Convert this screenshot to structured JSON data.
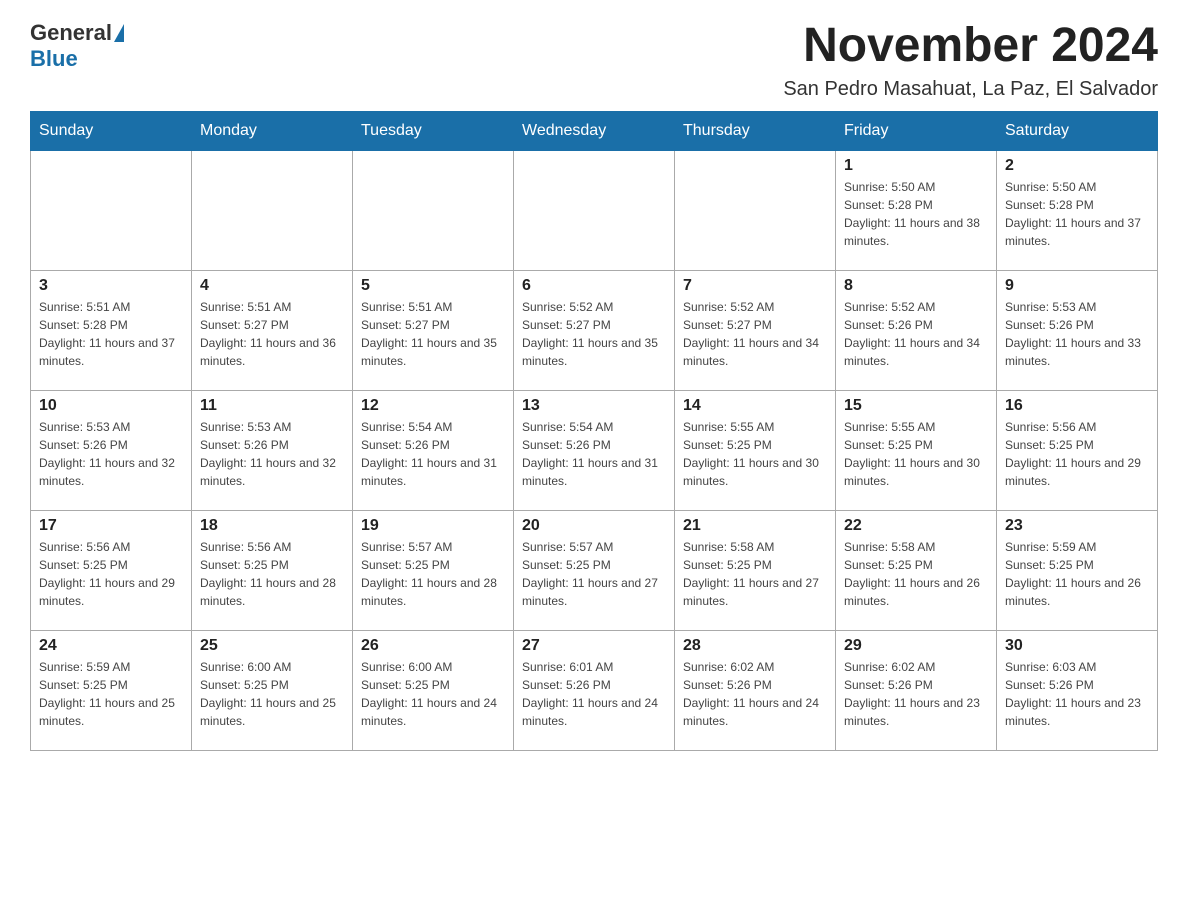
{
  "logo": {
    "general": "General",
    "blue": "Blue"
  },
  "header": {
    "title": "November 2024",
    "subtitle": "San Pedro Masahuat, La Paz, El Salvador"
  },
  "weekdays": [
    "Sunday",
    "Monday",
    "Tuesday",
    "Wednesday",
    "Thursday",
    "Friday",
    "Saturday"
  ],
  "weeks": [
    [
      {
        "day": "",
        "info": ""
      },
      {
        "day": "",
        "info": ""
      },
      {
        "day": "",
        "info": ""
      },
      {
        "day": "",
        "info": ""
      },
      {
        "day": "",
        "info": ""
      },
      {
        "day": "1",
        "info": "Sunrise: 5:50 AM\nSunset: 5:28 PM\nDaylight: 11 hours and 38 minutes."
      },
      {
        "day": "2",
        "info": "Sunrise: 5:50 AM\nSunset: 5:28 PM\nDaylight: 11 hours and 37 minutes."
      }
    ],
    [
      {
        "day": "3",
        "info": "Sunrise: 5:51 AM\nSunset: 5:28 PM\nDaylight: 11 hours and 37 minutes."
      },
      {
        "day": "4",
        "info": "Sunrise: 5:51 AM\nSunset: 5:27 PM\nDaylight: 11 hours and 36 minutes."
      },
      {
        "day": "5",
        "info": "Sunrise: 5:51 AM\nSunset: 5:27 PM\nDaylight: 11 hours and 35 minutes."
      },
      {
        "day": "6",
        "info": "Sunrise: 5:52 AM\nSunset: 5:27 PM\nDaylight: 11 hours and 35 minutes."
      },
      {
        "day": "7",
        "info": "Sunrise: 5:52 AM\nSunset: 5:27 PM\nDaylight: 11 hours and 34 minutes."
      },
      {
        "day": "8",
        "info": "Sunrise: 5:52 AM\nSunset: 5:26 PM\nDaylight: 11 hours and 34 minutes."
      },
      {
        "day": "9",
        "info": "Sunrise: 5:53 AM\nSunset: 5:26 PM\nDaylight: 11 hours and 33 minutes."
      }
    ],
    [
      {
        "day": "10",
        "info": "Sunrise: 5:53 AM\nSunset: 5:26 PM\nDaylight: 11 hours and 32 minutes."
      },
      {
        "day": "11",
        "info": "Sunrise: 5:53 AM\nSunset: 5:26 PM\nDaylight: 11 hours and 32 minutes."
      },
      {
        "day": "12",
        "info": "Sunrise: 5:54 AM\nSunset: 5:26 PM\nDaylight: 11 hours and 31 minutes."
      },
      {
        "day": "13",
        "info": "Sunrise: 5:54 AM\nSunset: 5:26 PM\nDaylight: 11 hours and 31 minutes."
      },
      {
        "day": "14",
        "info": "Sunrise: 5:55 AM\nSunset: 5:25 PM\nDaylight: 11 hours and 30 minutes."
      },
      {
        "day": "15",
        "info": "Sunrise: 5:55 AM\nSunset: 5:25 PM\nDaylight: 11 hours and 30 minutes."
      },
      {
        "day": "16",
        "info": "Sunrise: 5:56 AM\nSunset: 5:25 PM\nDaylight: 11 hours and 29 minutes."
      }
    ],
    [
      {
        "day": "17",
        "info": "Sunrise: 5:56 AM\nSunset: 5:25 PM\nDaylight: 11 hours and 29 minutes."
      },
      {
        "day": "18",
        "info": "Sunrise: 5:56 AM\nSunset: 5:25 PM\nDaylight: 11 hours and 28 minutes."
      },
      {
        "day": "19",
        "info": "Sunrise: 5:57 AM\nSunset: 5:25 PM\nDaylight: 11 hours and 28 minutes."
      },
      {
        "day": "20",
        "info": "Sunrise: 5:57 AM\nSunset: 5:25 PM\nDaylight: 11 hours and 27 minutes."
      },
      {
        "day": "21",
        "info": "Sunrise: 5:58 AM\nSunset: 5:25 PM\nDaylight: 11 hours and 27 minutes."
      },
      {
        "day": "22",
        "info": "Sunrise: 5:58 AM\nSunset: 5:25 PM\nDaylight: 11 hours and 26 minutes."
      },
      {
        "day": "23",
        "info": "Sunrise: 5:59 AM\nSunset: 5:25 PM\nDaylight: 11 hours and 26 minutes."
      }
    ],
    [
      {
        "day": "24",
        "info": "Sunrise: 5:59 AM\nSunset: 5:25 PM\nDaylight: 11 hours and 25 minutes."
      },
      {
        "day": "25",
        "info": "Sunrise: 6:00 AM\nSunset: 5:25 PM\nDaylight: 11 hours and 25 minutes."
      },
      {
        "day": "26",
        "info": "Sunrise: 6:00 AM\nSunset: 5:25 PM\nDaylight: 11 hours and 24 minutes."
      },
      {
        "day": "27",
        "info": "Sunrise: 6:01 AM\nSunset: 5:26 PM\nDaylight: 11 hours and 24 minutes."
      },
      {
        "day": "28",
        "info": "Sunrise: 6:02 AM\nSunset: 5:26 PM\nDaylight: 11 hours and 24 minutes."
      },
      {
        "day": "29",
        "info": "Sunrise: 6:02 AM\nSunset: 5:26 PM\nDaylight: 11 hours and 23 minutes."
      },
      {
        "day": "30",
        "info": "Sunrise: 6:03 AM\nSunset: 5:26 PM\nDaylight: 11 hours and 23 minutes."
      }
    ]
  ]
}
